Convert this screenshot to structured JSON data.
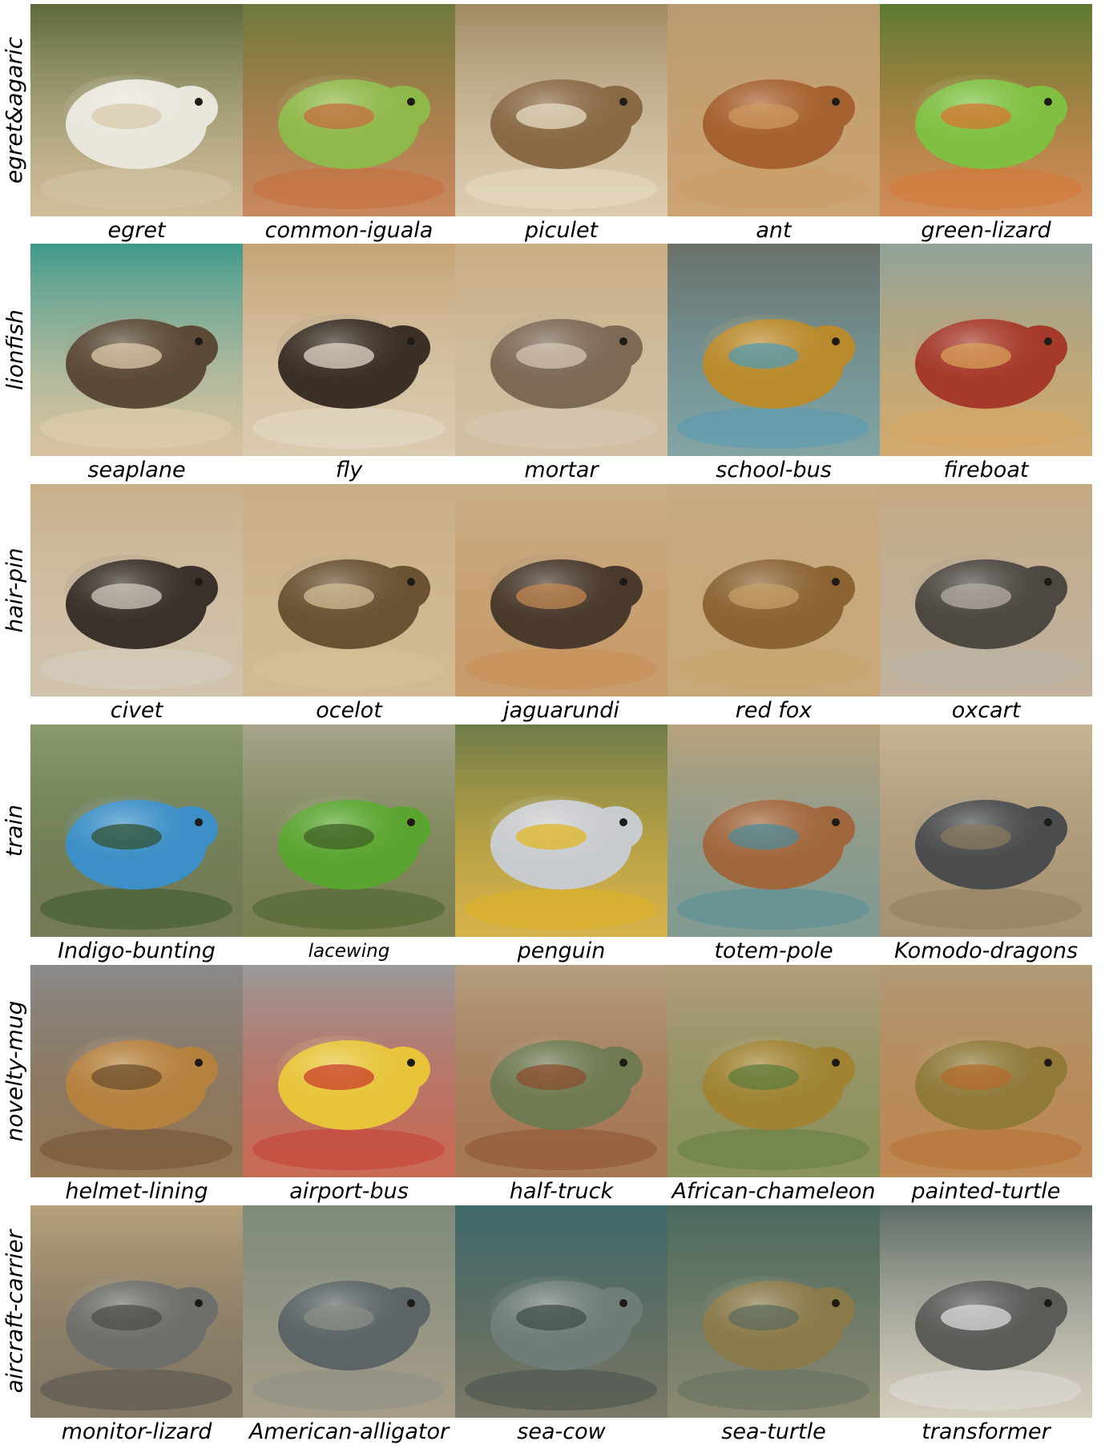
{
  "rows": [
    {
      "label": "egret&agaric",
      "items": [
        {
          "caption": "egret",
          "bg": "#5d6a3a",
          "subject": "#e9e6dc",
          "accent": "#d8c9a8"
        },
        {
          "caption": "common-iguala",
          "bg": "#6d7a3c",
          "subject": "#8fb84a",
          "accent": "#c9683a"
        },
        {
          "caption": "piculet",
          "bg": "#a08a62",
          "subject": "#8a6a45",
          "accent": "#ece2cc"
        },
        {
          "caption": "ant",
          "bg": "#b89c70",
          "subject": "#a5612f",
          "accent": "#cf9a62"
        },
        {
          "caption": "green-lizard",
          "bg": "#5c7a32",
          "subject": "#7fc043",
          "accent": "#d9702f"
        }
      ]
    },
    {
      "label": "lionfish",
      "items": [
        {
          "caption": "seaplane",
          "bg": "#3f9a8c",
          "subject": "#5b4a36",
          "accent": "#e6d2b2"
        },
        {
          "caption": "fly",
          "bg": "#c4a374",
          "subject": "#3b3026",
          "accent": "#e9dfcf"
        },
        {
          "caption": "mortar",
          "bg": "#c9ae84",
          "subject": "#7d6a55",
          "accent": "#d8cbb7"
        },
        {
          "caption": "school-bus",
          "bg": "#6a7068",
          "subject": "#b98a2c",
          "accent": "#4b9ab8"
        },
        {
          "caption": "fireboat",
          "bg": "#8fa39a",
          "subject": "#a53a2a",
          "accent": "#d9a55a"
        }
      ]
    },
    {
      "label": "hair-pin",
      "items": [
        {
          "caption": "civet",
          "bg": "#c9b08a",
          "subject": "#3a322a",
          "accent": "#d8d2c8"
        },
        {
          "caption": "ocelot",
          "bg": "#c8ad86",
          "subject": "#6b5233",
          "accent": "#d9c39a"
        },
        {
          "caption": "jaguarundi",
          "bg": "#c9af88",
          "subject": "#4a3a2c",
          "accent": "#c78b52"
        },
        {
          "caption": "red fox",
          "bg": "#c6ab84",
          "subject": "#8c6434",
          "accent": "#c9a26a"
        },
        {
          "caption": "oxcart",
          "bg": "#c5aa83",
          "subject": "#4e4842",
          "accent": "#b9b3aa"
        }
      ]
    },
    {
      "label": "train",
      "items": [
        {
          "caption": "Indigo-bunting",
          "bg": "#8a9a6e",
          "subject": "#3c8fc7",
          "accent": "#2f4f2a"
        },
        {
          "caption": "lacewing",
          "bg": "#a7a48b",
          "subject": "#5aa530",
          "accent": "#3d5a24"
        },
        {
          "caption": "penguin",
          "bg": "#6e7c4a",
          "subject": "#c9ccce",
          "accent": "#e3b41a"
        },
        {
          "caption": "totem-pole",
          "bg": "#b9a27c",
          "subject": "#a0673d",
          "accent": "#4a8a9a"
        },
        {
          "caption": "Komodo-dragons",
          "bg": "#c9b594",
          "subject": "#4a4c4e",
          "accent": "#8c7a5e"
        }
      ]
    },
    {
      "label": "novelty-mug",
      "items": [
        {
          "caption": "helmet-lining",
          "bg": "#8a8a8a",
          "subject": "#b5813f",
          "accent": "#6a4a2a"
        },
        {
          "caption": "airport-bus",
          "bg": "#9a9a9a",
          "subject": "#e7c43a",
          "accent": "#c8342a"
        },
        {
          "caption": "half-truck",
          "bg": "#b49f7e",
          "subject": "#6f7a52",
          "accent": "#8a4a2a"
        },
        {
          "caption": "African-chameleon",
          "bg": "#b39e7c",
          "subject": "#a08434",
          "accent": "#5a7a3a"
        },
        {
          "caption": "painted-turtle",
          "bg": "#b09a78",
          "subject": "#8f7a3a",
          "accent": "#b56a2a"
        }
      ]
    },
    {
      "label": "aircraft-carrier",
      "items": [
        {
          "caption": "monitor-lizard",
          "bg": "#b7a07a",
          "subject": "#6e6e6a",
          "accent": "#4a4a46"
        },
        {
          "caption": "American-alligator",
          "bg": "#7d8a7a",
          "subject": "#5c6466",
          "accent": "#8a8e86"
        },
        {
          "caption": "sea-cow",
          "bg": "#3f6a6c",
          "subject": "#6f7c78",
          "accent": "#3c4a48"
        },
        {
          "caption": "sea-turtle",
          "bg": "#4a6a5e",
          "subject": "#8a7a4a",
          "accent": "#5a6a5c"
        },
        {
          "caption": "transformer",
          "bg": "#5d6b64",
          "subject": "#5a5c58",
          "accent": "#dfe3e2"
        }
      ]
    }
  ]
}
